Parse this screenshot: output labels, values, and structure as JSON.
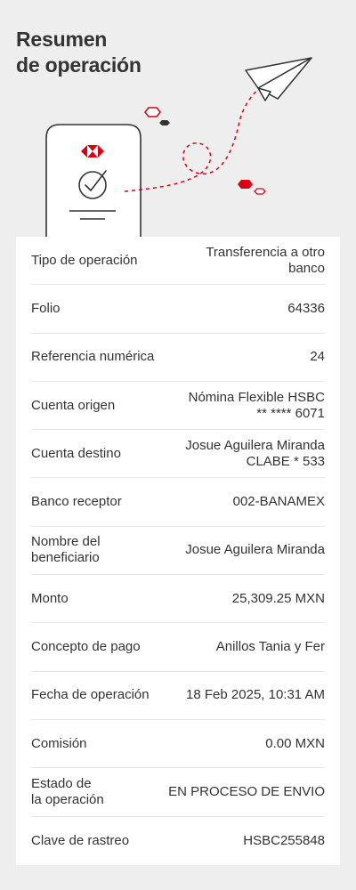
{
  "page": {
    "title": "Resumen\nde operación"
  },
  "colors": {
    "brand_red": "#db0011",
    "background": "#eeeeee",
    "card": "#ffffff"
  },
  "illustration": {
    "icons": [
      "phone-icon",
      "hsbc-logo-icon",
      "check-circle-icon",
      "paper-plane-icon"
    ]
  },
  "details": [
    {
      "label": "Tipo de operación",
      "value": "Transferencia a otro\nbanco"
    },
    {
      "label": "Folio",
      "value": "64336"
    },
    {
      "label": "Referencia numérica",
      "value": "24"
    },
    {
      "label": "Cuenta origen",
      "value": "Nómina Flexible HSBC\n** **** 6071"
    },
    {
      "label": "Cuenta destino",
      "value": "Josue Aguilera Miranda\nCLABE * 533"
    },
    {
      "label": "Banco receptor",
      "value": "002-BANAMEX"
    },
    {
      "label": "Nombre del\nbeneficiario",
      "value": "Josue Aguilera Miranda"
    },
    {
      "label": "Monto",
      "value": "25,309.25 MXN"
    },
    {
      "label": "Concepto de pago",
      "value": "Anillos Tania y Fer"
    },
    {
      "label": "Fecha de operación",
      "value": "18 Feb 2025, 10:31 AM"
    },
    {
      "label": "Comisión",
      "value": "0.00 MXN"
    },
    {
      "label": "Estado de\nla operación",
      "value": "EN PROCESO DE ENVIO"
    },
    {
      "label": "Clave de rastreo",
      "value": "HSBC255848"
    }
  ]
}
